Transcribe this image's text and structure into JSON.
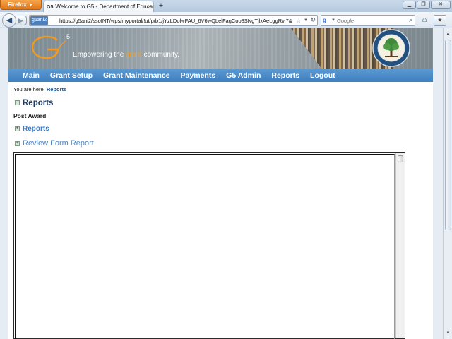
{
  "browser": {
    "app_button": "Firefox",
    "tab_title": "Welcome to G5 - Department of Educati...",
    "tab_favicon": "G5",
    "site_identity": "g5ani2",
    "url": "https://g5ani2/ssoINT/wps/myportal/!ut/p/b1/jYzLDolwFAU_6V6wQLelFagCoo8SNgTjlxAeLggRvl7&",
    "search_placeholder": "Google",
    "icons": [
      "back-arrow-icon",
      "forward-arrow-icon",
      "star-icon",
      "reload-icon",
      "google-icon",
      "search-icon",
      "home-icon",
      "bookmarks-icon"
    ]
  },
  "banner": {
    "logo_text": "G",
    "logo_superscript": "5",
    "tagline_prefix": "Empowering the ",
    "tagline_accent": "grant",
    "tagline_suffix": " community."
  },
  "menu": {
    "items": [
      "Main",
      "Grant Setup",
      "Grant Maintenance",
      "Payments",
      "G5 Admin",
      "Reports",
      "Logout"
    ]
  },
  "breadcrumb": {
    "prefix": "You are here:",
    "current": "Reports"
  },
  "content": {
    "section_title": "Reports",
    "subheading": "Post Award",
    "reports_link": "Reports",
    "review_form_link": "Review Form Report"
  },
  "colors": {
    "menu_bar": "#4a8ac8",
    "tagline_accent": "#f3a021",
    "link_blue": "#3d7cc4",
    "title_navy": "#1e3d66"
  }
}
